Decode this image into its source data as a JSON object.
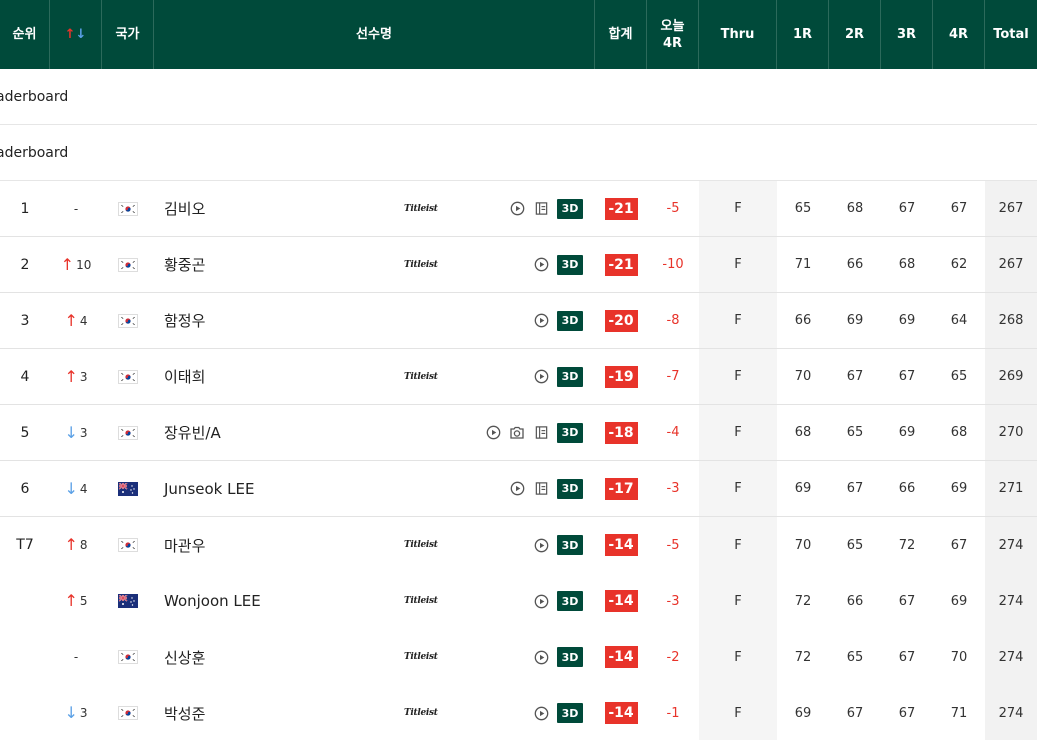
{
  "header": {
    "rank": "순위",
    "move_up": "↑",
    "move_down": "↓",
    "nation": "국가",
    "player": "선수명",
    "total_to_par": "합계",
    "today_line1": "오늘",
    "today_line2": "4R",
    "thru": "Thru",
    "r1": "1R",
    "r2": "2R",
    "r3": "3R",
    "r4": "4R",
    "total": "Total"
  },
  "sections": [
    {
      "label": "aderboard"
    },
    {
      "label": "aderboard"
    }
  ],
  "colors": {
    "header_bg": "#004a3a",
    "score_red": "#e8332a",
    "up_red": "#e8332a",
    "down_blue": "#5aa0e6"
  },
  "sponsor_logo_text": "Titleist",
  "button_3d_label": "3D",
  "rows": [
    {
      "rank": "1",
      "move_dir": "none",
      "move": "-",
      "nation": "KOR",
      "name": "김비오",
      "logo": true,
      "icons": [
        "play-icon",
        "scorecard-icon"
      ],
      "to_par": "-21",
      "today": "-5",
      "thru": "F",
      "r1": "65",
      "r2": "68",
      "r3": "67",
      "r4": "67",
      "total": "267"
    },
    {
      "rank": "2",
      "move_dir": "up",
      "move": "10",
      "nation": "KOR",
      "name": "황중곤",
      "logo": true,
      "icons": [
        "play-icon"
      ],
      "to_par": "-21",
      "today": "-10",
      "thru": "F",
      "r1": "71",
      "r2": "66",
      "r3": "68",
      "r4": "62",
      "total": "267"
    },
    {
      "rank": "3",
      "move_dir": "up",
      "move": "4",
      "nation": "KOR",
      "name": "함정우",
      "logo": false,
      "icons": [
        "play-icon"
      ],
      "to_par": "-20",
      "today": "-8",
      "thru": "F",
      "r1": "66",
      "r2": "69",
      "r3": "69",
      "r4": "64",
      "total": "268"
    },
    {
      "rank": "4",
      "move_dir": "up",
      "move": "3",
      "nation": "KOR",
      "name": "이태희",
      "logo": true,
      "icons": [
        "play-icon"
      ],
      "to_par": "-19",
      "today": "-7",
      "thru": "F",
      "r1": "70",
      "r2": "67",
      "r3": "67",
      "r4": "65",
      "total": "269"
    },
    {
      "rank": "5",
      "move_dir": "down",
      "move": "3",
      "nation": "KOR",
      "name": "장유빈/A",
      "logo": false,
      "icons": [
        "play-icon",
        "camera-icon",
        "scorecard-icon"
      ],
      "to_par": "-18",
      "today": "-4",
      "thru": "F",
      "r1": "68",
      "r2": "65",
      "r3": "69",
      "r4": "68",
      "total": "270"
    },
    {
      "rank": "6",
      "move_dir": "down",
      "move": "4",
      "nation": "AUS",
      "name": "Junseok LEE",
      "logo": false,
      "icons": [
        "play-icon",
        "scorecard-icon"
      ],
      "to_par": "-17",
      "today": "-3",
      "thru": "F",
      "r1": "69",
      "r2": "67",
      "r3": "66",
      "r4": "69",
      "total": "271"
    },
    {
      "rank": "T7",
      "move_dir": "up",
      "move": "8",
      "nation": "KOR",
      "name": "마관우",
      "logo": true,
      "icons": [
        "play-icon"
      ],
      "to_par": "-14",
      "today": "-5",
      "thru": "F",
      "r1": "70",
      "r2": "65",
      "r3": "72",
      "r4": "67",
      "total": "274"
    },
    {
      "rank": "",
      "move_dir": "up",
      "move": "5",
      "nation": "AUS",
      "name": "Wonjoon LEE",
      "logo": true,
      "icons": [
        "play-icon"
      ],
      "to_par": "-14",
      "today": "-3",
      "thru": "F",
      "r1": "72",
      "r2": "66",
      "r3": "67",
      "r4": "69",
      "total": "274"
    },
    {
      "rank": "",
      "move_dir": "none",
      "move": "-",
      "nation": "KOR",
      "name": "신상훈",
      "logo": true,
      "icons": [
        "play-icon"
      ],
      "to_par": "-14",
      "today": "-2",
      "thru": "F",
      "r1": "72",
      "r2": "65",
      "r3": "67",
      "r4": "70",
      "total": "274"
    },
    {
      "rank": "",
      "move_dir": "down",
      "move": "3",
      "nation": "KOR",
      "name": "박성준",
      "logo": true,
      "icons": [
        "play-icon"
      ],
      "to_par": "-14",
      "today": "-1",
      "thru": "F",
      "r1": "69",
      "r2": "67",
      "r3": "67",
      "r4": "71",
      "total": "274"
    }
  ]
}
